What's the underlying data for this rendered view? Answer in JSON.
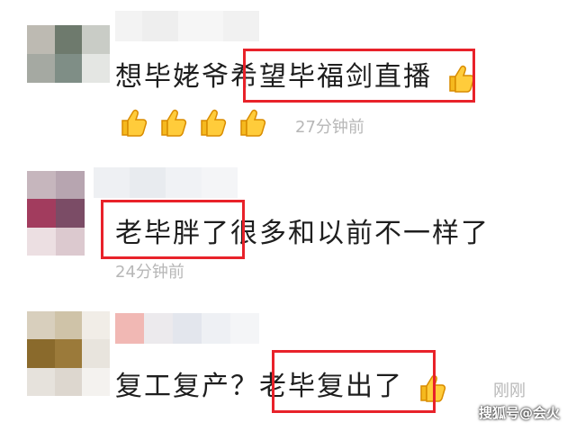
{
  "comments": [
    {
      "text_before": "想毕姥爷",
      "text_highlight": "希望毕福剑直播",
      "text_after": "",
      "time": "27分钟前",
      "emoji": "thumbs-up",
      "emoji_count_inline": 1,
      "emoji_count_next_line": 4
    },
    {
      "text_before": "",
      "text_highlight": "老毕胖了",
      "text_after": "很多和以前不一样了",
      "time": "24分钟前"
    },
    {
      "text_before": "复工复产？",
      "text_highlight": "老毕复出了",
      "text_after": "",
      "time": "刚刚",
      "emoji": "thumbs-up",
      "emoji_count_inline": 1
    }
  ],
  "watermark": "搜狐号@会火",
  "colors": {
    "highlight_border": "#e8222a",
    "text": "#1e1e1e",
    "time": "#b7b7b7"
  }
}
